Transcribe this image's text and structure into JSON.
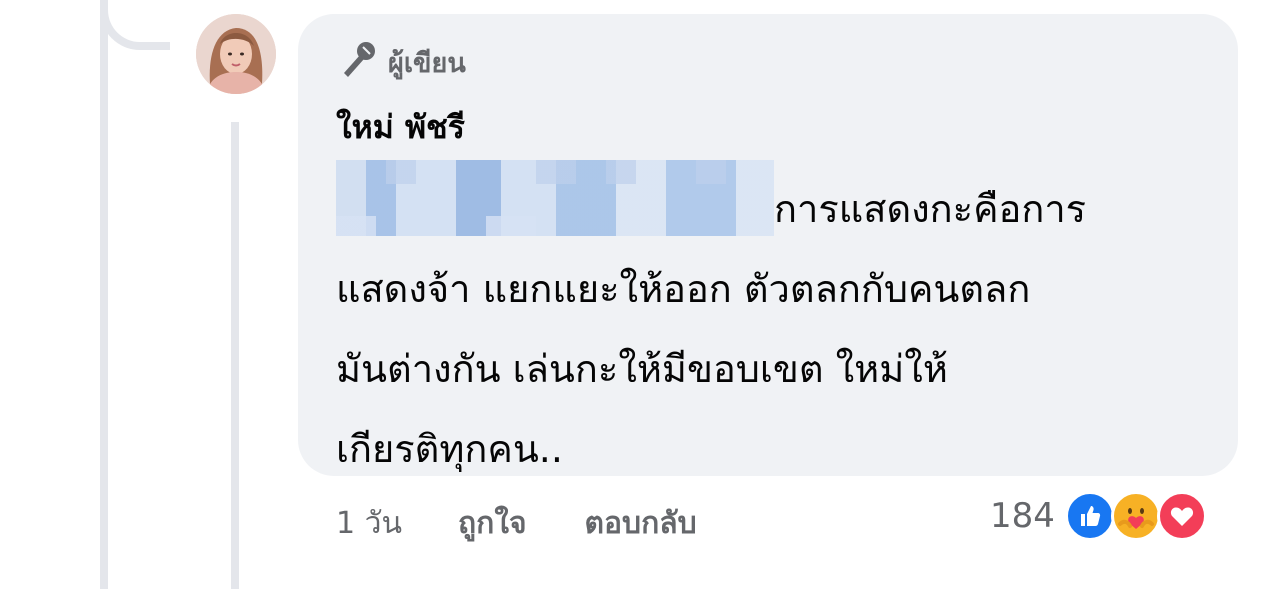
{
  "comment": {
    "author_badge": "ผู้เขียน",
    "author_name": "ใหม่ พัชรี",
    "text_line1_visible": "การแสดงกะคือการ",
    "text_line2": "แสดงจ้า แยกแยะให้ออก ตัวตลกกับคนตลก",
    "text_line3": "มันต่างกัน  เล่นกะให้มีขอบเขต  ใหม่ให้",
    "text_line4": "เกียรติทุกคน..",
    "time": "1 วัน",
    "like_label": "ถูกใจ",
    "reply_label": "ตอบกลับ",
    "reaction_count": "184",
    "reactions": [
      "like-icon",
      "care-icon",
      "love-icon"
    ],
    "avatar_icon": "avatar",
    "badge_icon": "microphone-icon"
  },
  "colors": {
    "bubble": "#f0f2f5",
    "muted_text": "#65676b",
    "text": "#050505",
    "like_blue": "#1877f2",
    "love_red": "#f33e58",
    "care_yellow": "#f7b125"
  }
}
